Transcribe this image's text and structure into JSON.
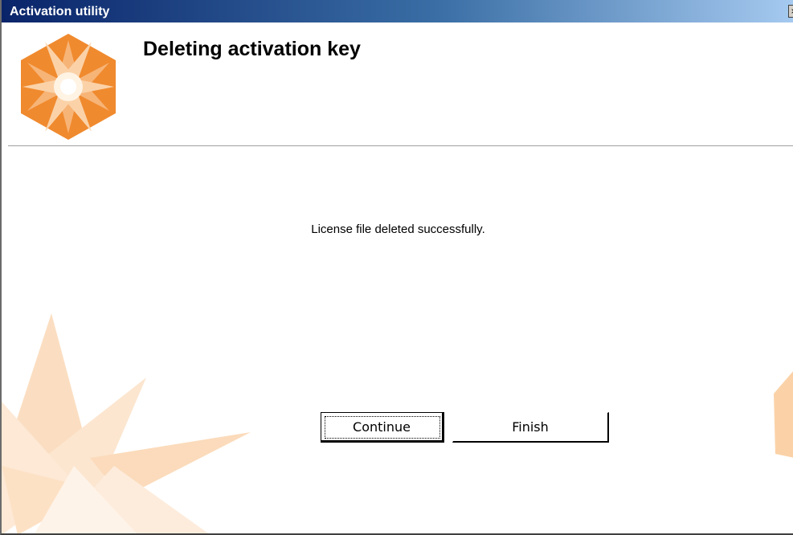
{
  "window": {
    "title": "Activation utility",
    "close_glyph": "×"
  },
  "header": {
    "heading": "Deleting activation key",
    "logo_icon": "orange-hexagon-star-logo"
  },
  "main": {
    "message": "License file deleted successfully."
  },
  "buttons": {
    "continue_label": "Continue",
    "finish_label": "Finish"
  },
  "colors": {
    "accent": "#f08a2e",
    "accent_light": "#fbd2a8",
    "titlebar_start": "#0a246a",
    "titlebar_end": "#a6caf0"
  }
}
